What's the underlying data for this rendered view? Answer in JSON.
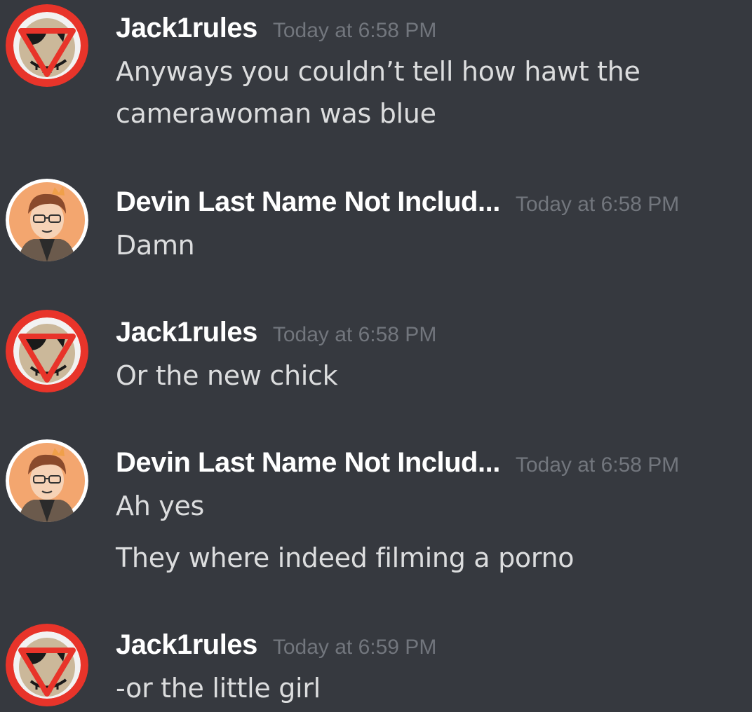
{
  "messages": [
    {
      "author": "Jack1rules",
      "avatar_icon": "pumpkin-mask-avatar-icon",
      "timestamp": "Today at 6:58 PM",
      "lines": [
        "Anyways you couldn’t tell how hawt the",
        "camerawoman was blue"
      ]
    },
    {
      "author": "Devin Last Name Not Includ...",
      "avatar_icon": "cartoon-boy-glasses-avatar-icon",
      "timestamp": "Today at 6:58 PM",
      "lines": [
        "Damn"
      ]
    },
    {
      "author": "Jack1rules",
      "avatar_icon": "pumpkin-mask-avatar-icon",
      "timestamp": "Today at 6:58 PM",
      "lines": [
        "Or the new chick"
      ]
    },
    {
      "author": "Devin Last Name Not Includ...",
      "avatar_icon": "cartoon-boy-glasses-avatar-icon",
      "timestamp": "Today at 6:58 PM",
      "lines": [
        "Ah yes",
        "They where indeed filming a porno"
      ]
    },
    {
      "author": "Jack1rules",
      "avatar_icon": "pumpkin-mask-avatar-icon",
      "timestamp": "Today at 6:59 PM",
      "lines": [
        "-or the little girl"
      ]
    }
  ],
  "colors": {
    "background": "#36393f",
    "username": "#ffffff",
    "timestamp": "#72767d",
    "message_text": "#dcddde",
    "avatar_red_ring": "#e8342a"
  }
}
